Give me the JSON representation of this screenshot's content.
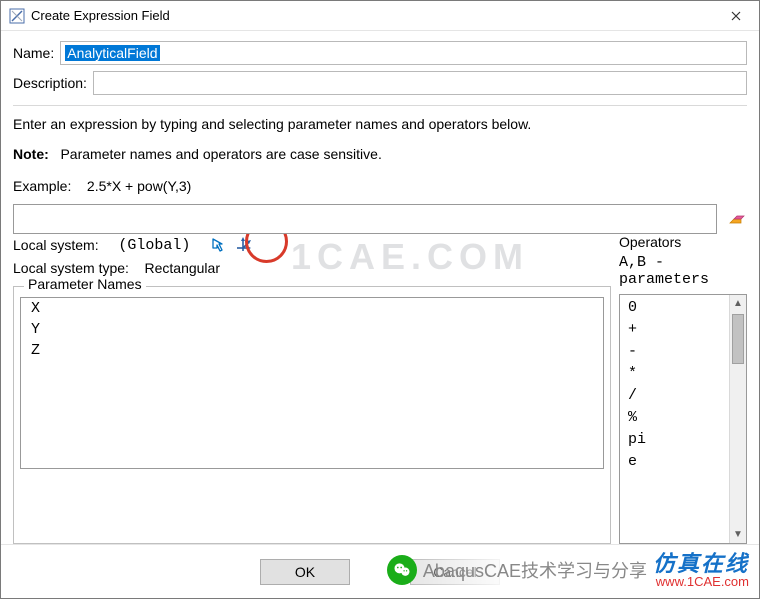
{
  "title": "Create Expression Field",
  "labels": {
    "name": "Name:",
    "description": "Description:",
    "instruction": "Enter an expression by typing and selecting parameter names and operators below.",
    "note_prefix": "Note:",
    "note_body": "Parameter names and operators are case sensitive.",
    "example_prefix": "Example:",
    "example_body": "2.5*X + pow(Y,3)",
    "local_system": "Local system:",
    "local_system_value": "(Global)",
    "local_system_type": "Local system type:",
    "local_system_type_value": "Rectangular",
    "parameter_names_title": "Parameter Names",
    "operators_title": "Operators",
    "operators_subtitle": "A,B - parameters",
    "ok": "OK",
    "cancel": "Cancel"
  },
  "fields": {
    "name_value": "AnalyticalField",
    "description_value": "",
    "expression_value": ""
  },
  "parameters": [
    "X",
    "Y",
    "Z"
  ],
  "operators": [
    "0",
    "+",
    "-",
    "*",
    "/",
    "%",
    "pi",
    "e"
  ],
  "watermarks": {
    "top": "1CAE.COM",
    "bottom": "1CAE.COM"
  },
  "footer": {
    "wechat_text": "AbaqusCAE技术学习与分享",
    "brand_cn": "仿真在线",
    "brand_url": "www.1CAE.com"
  }
}
